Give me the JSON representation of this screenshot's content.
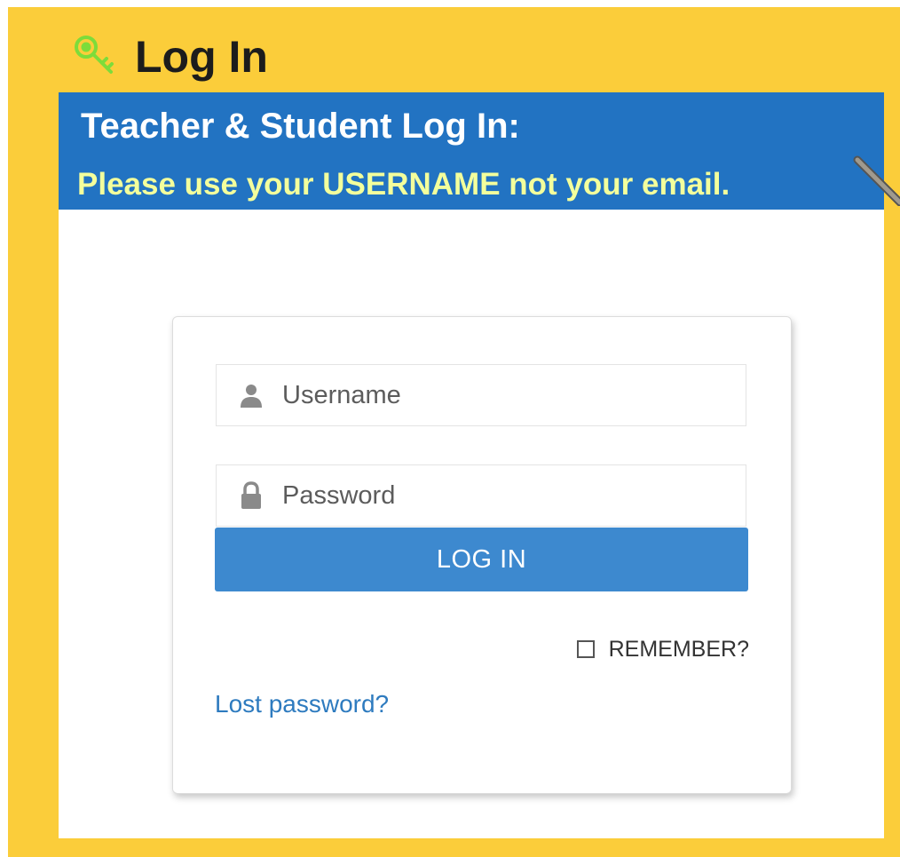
{
  "header": {
    "title": "Log In",
    "icon": "key-icon"
  },
  "banner": {
    "title": "Teacher & Student Log In:",
    "subtitle": "Please use your USERNAME not your email."
  },
  "form": {
    "username_placeholder": "Username",
    "password_placeholder": "Password",
    "username_icon": "user-icon",
    "password_icon": "lock-icon",
    "submit_label": "LOG IN",
    "remember_label": "REMEMBER?",
    "remember_checked": false,
    "lost_password_label": "Lost password?"
  },
  "colors": {
    "page_background": "#fbcd3a",
    "banner": "#2273c2",
    "banner_subtitle": "#f3ff9c",
    "button": "#3d89cf",
    "link": "#2e7bbf"
  }
}
